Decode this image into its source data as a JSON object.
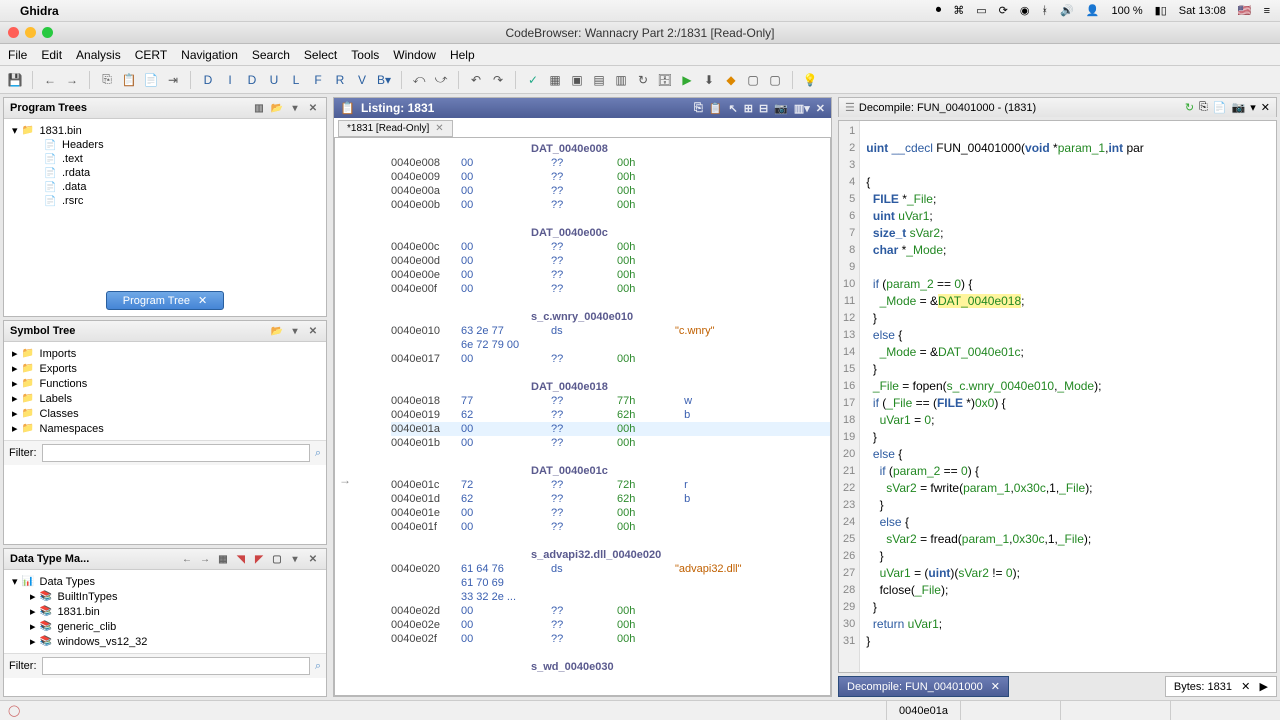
{
  "mac": {
    "app": "Ghidra",
    "battery": "100 %",
    "clock": "Sat 13:08"
  },
  "window_title": "CodeBrowser: Wannacry Part 2:/1831 [Read-Only]",
  "menus": [
    "File",
    "Edit",
    "Analysis",
    "CERT",
    "Navigation",
    "Search",
    "Select",
    "Tools",
    "Window",
    "Help"
  ],
  "program_trees": {
    "title": "Program Trees",
    "root": "1831.bin",
    "children": [
      "Headers",
      ".text",
      ".rdata",
      ".data",
      ".rsrc"
    ],
    "tab": "Program Tree"
  },
  "symbol_tree": {
    "title": "Symbol Tree",
    "items": [
      "Imports",
      "Exports",
      "Functions",
      "Labels",
      "Classes",
      "Namespaces"
    ],
    "filter": "Filter:"
  },
  "dtm": {
    "title": "Data Type Ma...",
    "root": "Data Types",
    "items": [
      "BuiltInTypes",
      "1831.bin",
      "generic_clib",
      "windows_vs12_32"
    ],
    "filter": "Filter:"
  },
  "listing": {
    "title": "Listing: 1831",
    "tab": "*1831 [Read-Only]",
    "lines": [
      {
        "t": "sym",
        "s": "DAT_0040e008"
      },
      {
        "a": "0040e008",
        "b": "00",
        "m": "??",
        "o": "00h"
      },
      {
        "a": "0040e009",
        "b": "00",
        "m": "??",
        "o": "00h"
      },
      {
        "a": "0040e00a",
        "b": "00",
        "m": "??",
        "o": "00h"
      },
      {
        "a": "0040e00b",
        "b": "00",
        "m": "??",
        "o": "00h"
      },
      {
        "t": "gap"
      },
      {
        "t": "sym",
        "s": "DAT_0040e00c"
      },
      {
        "a": "0040e00c",
        "b": "00",
        "m": "??",
        "o": "00h"
      },
      {
        "a": "0040e00d",
        "b": "00",
        "m": "??",
        "o": "00h"
      },
      {
        "a": "0040e00e",
        "b": "00",
        "m": "??",
        "o": "00h"
      },
      {
        "a": "0040e00f",
        "b": "00",
        "m": "??",
        "o": "00h"
      },
      {
        "t": "gap"
      },
      {
        "t": "sym",
        "s": "s_c.wnry_0040e010"
      },
      {
        "a": "0040e010",
        "b": "63 2e 77",
        "m": "ds",
        "o": "",
        "c": "\"c.wnry\""
      },
      {
        "a": "",
        "b": "6e 72 79 00",
        "m": "",
        "o": ""
      },
      {
        "a": "0040e017",
        "b": "00",
        "m": "??",
        "o": "00h"
      },
      {
        "t": "gap"
      },
      {
        "t": "sym",
        "s": "DAT_0040e018"
      },
      {
        "a": "0040e018",
        "b": "77",
        "m": "??",
        "o": "77h",
        "c": "w"
      },
      {
        "a": "0040e019",
        "b": "62",
        "m": "??",
        "o": "62h",
        "c": "b"
      },
      {
        "a": "0040e01a",
        "b": "00",
        "m": "??",
        "o": "00h",
        "cur": true
      },
      {
        "a": "0040e01b",
        "b": "00",
        "m": "??",
        "o": "00h"
      },
      {
        "t": "gap"
      },
      {
        "t": "sym",
        "s": "DAT_0040e01c"
      },
      {
        "a": "0040e01c",
        "b": "72",
        "m": "??",
        "o": "72h",
        "c": "r"
      },
      {
        "a": "0040e01d",
        "b": "62",
        "m": "??",
        "o": "62h",
        "c": "b"
      },
      {
        "a": "0040e01e",
        "b": "00",
        "m": "??",
        "o": "00h"
      },
      {
        "a": "0040e01f",
        "b": "00",
        "m": "??",
        "o": "00h"
      },
      {
        "t": "gap"
      },
      {
        "t": "sym",
        "s": "s_advapi32.dll_0040e020"
      },
      {
        "a": "0040e020",
        "b": "61 64 76",
        "m": "ds",
        "o": "",
        "c": "\"advapi32.dll\""
      },
      {
        "a": "",
        "b": "61 70 69",
        "m": "",
        "o": ""
      },
      {
        "a": "",
        "b": "33 32 2e ...",
        "m": "",
        "o": ""
      },
      {
        "a": "0040e02d",
        "b": "00",
        "m": "??",
        "o": "00h"
      },
      {
        "a": "0040e02e",
        "b": "00",
        "m": "??",
        "o": "00h"
      },
      {
        "a": "0040e02f",
        "b": "00",
        "m": "??",
        "o": "00h"
      },
      {
        "t": "gap"
      },
      {
        "t": "sym",
        "s": "s_wd_0040e030"
      }
    ]
  },
  "decompile": {
    "title": "Decompile: FUN_00401000 - (1831)",
    "code": [
      "",
      "uint __cdecl FUN_00401000(void *param_1,int par",
      "",
      "{",
      "  FILE *_File;",
      "  uint uVar1;",
      "  size_t sVar2;",
      "  char *_Mode;",
      "",
      "  if (param_2 == 0) {",
      "    _Mode = &DAT_0040e018;",
      "  }",
      "  else {",
      "    _Mode = &DAT_0040e01c;",
      "  }",
      "  _File = fopen(s_c.wnry_0040e010,_Mode);",
      "  if (_File == (FILE *)0x0) {",
      "    uVar1 = 0;",
      "  }",
      "  else {",
      "    if (param_2 == 0) {",
      "      sVar2 = fwrite(param_1,0x30c,1,_File);",
      "    }",
      "    else {",
      "      sVar2 = fread(param_1,0x30c,1,_File);",
      "    }",
      "    uVar1 = (uint)(sVar2 != 0);",
      "    fclose(_File);",
      "  }",
      "  return uVar1;",
      "}"
    ],
    "tab": "Decompile: FUN_00401000",
    "bytes": "Bytes: 1831"
  },
  "status_addr": "0040e01a"
}
